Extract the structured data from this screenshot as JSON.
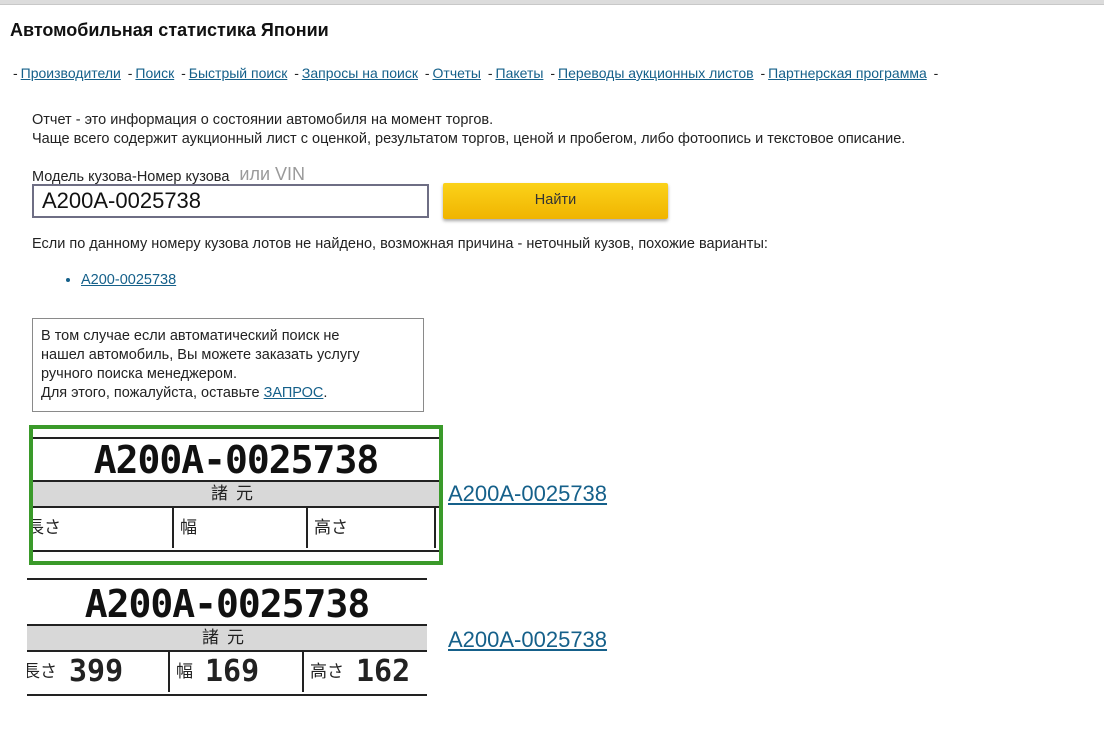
{
  "header": {
    "title": "Автомобильная статистика Японии"
  },
  "nav": {
    "items": [
      "Производители",
      "Поиск",
      "Быстрый поиск",
      "Запросы на поиск",
      "Отчеты",
      "Пакеты",
      "Переводы аукционных листов",
      "Партнерская программа"
    ],
    "separator": "-"
  },
  "info": {
    "line1": "Отчет - это информация о состоянии автомобиля на момент торгов.",
    "line2": "Чаще всего содержит аукционный лист с оценкой, результатом торгов, ценой и пробегом, либо фотоопись и текстовое описание."
  },
  "search": {
    "label": "Модель кузова-Номер кузова",
    "alt_label": "или VIN",
    "value": "A200A-0025738",
    "button_label": "Найти"
  },
  "results": {
    "not_found_text": "Если по данному номеру кузова лотов не найдено, возможная причина - неточный кузов, похожие варианты:",
    "variants": [
      "A200-0025738"
    ]
  },
  "notice": {
    "line1": "В том случае если автоматический поиск не",
    "line2": "нашел автомобиль, Вы можете заказать услугу",
    "line3": "ручного поиска менеджером.",
    "line4_prefix": "Для этого, пожалуйста, оставьте ",
    "link": "ЗАПРОС",
    "line4_suffix": "."
  },
  "lots": [
    {
      "plate_vin": "A200A-0025738",
      "plate_band": "諸元",
      "cells": [
        "長さ",
        "幅",
        "高さ"
      ],
      "cell_values": [
        "",
        "",
        ""
      ],
      "link": "A200A-0025738",
      "highlighted": true
    },
    {
      "plate_vin": "A200A-0025738",
      "plate_band": "諸元",
      "cells": [
        "長さ",
        "幅",
        "高さ"
      ],
      "cell_values": [
        "399",
        "169",
        "162"
      ],
      "link": "A200A-0025738",
      "highlighted": false
    }
  ],
  "colors": {
    "link": "#15608a",
    "button": "#f5c20c",
    "highlight_border": "#3a9a2a"
  }
}
